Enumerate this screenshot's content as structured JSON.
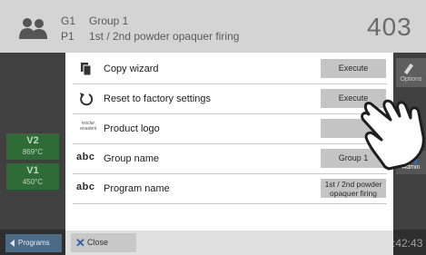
{
  "header": {
    "group_code": "G1",
    "group_name": "Group 1",
    "program_code": "P1",
    "program_name": "1st / 2nd powder opaquer firing",
    "temperature": "403"
  },
  "side": {
    "v2_label": "V2",
    "v2_temp": "869°C",
    "v1_label": "V1",
    "v1_temp": "450°C",
    "options_label": "Options",
    "admin_label": "Admin",
    "programs_label": "Programs",
    "clock": ":42:43"
  },
  "dialog": {
    "rows": [
      {
        "label": "Copy wizard",
        "button": "Execute",
        "icon": "copy-icon"
      },
      {
        "label": "Reset to factory settings",
        "button": "Execute",
        "icon": "reset-icon"
      },
      {
        "label": "Product logo",
        "button": "",
        "icon": "logo-icon",
        "icon_text": "ivoclar vivadent"
      },
      {
        "label": "Group name",
        "button": "Group 1",
        "icon": "abc-icon",
        "icon_text": "abc"
      },
      {
        "label": "Program name",
        "button": "1st / 2nd powder opaquer firing",
        "icon": "abc-icon",
        "icon_text": "abc"
      }
    ],
    "close_label": "Close"
  },
  "colors": {
    "header_bg": "#d4d4d4",
    "badge_green": "#2e6b36",
    "button_grey": "#c4c4c4",
    "close_x_blue": "#2b5fa6"
  }
}
